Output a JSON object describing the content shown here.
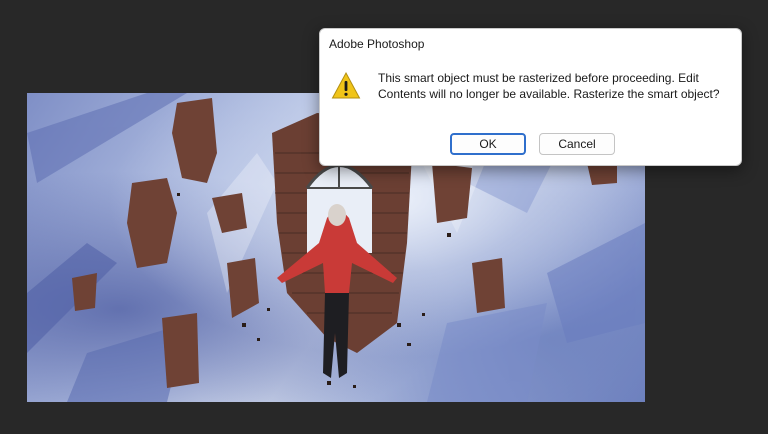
{
  "canvas": {
    "artwork": "brick-wall-figure-artwork"
  },
  "dialog": {
    "title": "Adobe Photoshop",
    "icon": "warning-icon",
    "message_line1": "This smart object must be rasterized before proceeding.  Edit",
    "message_line2": "Contents will no longer be available.  Rasterize the smart object?",
    "ok_label": "OK",
    "cancel_label": "Cancel"
  },
  "colors": {
    "app_background": "#282828",
    "warning_yellow": "#f0c419",
    "default_button_border": "#2f6fcc"
  }
}
